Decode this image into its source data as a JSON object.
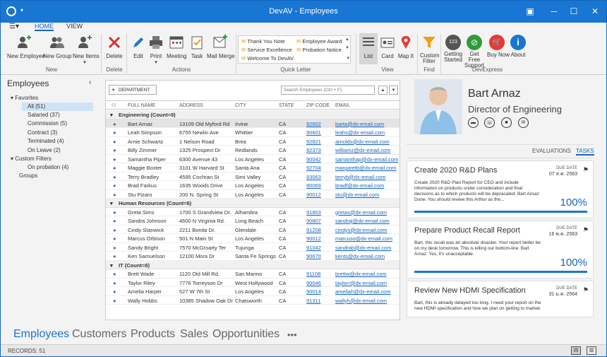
{
  "app": {
    "title": "DevAV - Employees"
  },
  "ribbon_tabs": [
    "HOME",
    "VIEW"
  ],
  "ribbon": {
    "buttons": [
      {
        "label": "New Employee",
        "icon": "add-person-icon",
        "group": "New"
      },
      {
        "label": "New Group",
        "icon": "add-group-icon",
        "group": "New"
      },
      {
        "label": "New Items",
        "icon": "add-items-icon",
        "group": "New"
      },
      {
        "label": "Delete",
        "icon": "delete-icon",
        "group": "Delete"
      },
      {
        "label": "Edit",
        "icon": "edit-icon",
        "group": "Actions"
      },
      {
        "label": "Print",
        "icon": "print-icon",
        "group": "Actions"
      },
      {
        "label": "Meeting",
        "icon": "meeting-icon",
        "group": "Actions"
      },
      {
        "label": "Task",
        "icon": "task-icon",
        "group": "Actions"
      },
      {
        "label": "Mail Merge",
        "icon": "mail-merge-icon",
        "group": "Actions"
      },
      {
        "label": "List",
        "icon": "list-icon",
        "group": "View"
      },
      {
        "label": "Card",
        "icon": "card-icon",
        "group": "View"
      },
      {
        "label": "Map It",
        "icon": "map-icon",
        "group": "View"
      },
      {
        "label": "Custom Filter",
        "icon": "filter-icon",
        "group": "Find"
      },
      {
        "label": "Getting Started",
        "icon": "getting-started-icon",
        "group": "DevExpress"
      },
      {
        "label": "Get Free Support",
        "icon": "support-icon",
        "group": "DevExpress"
      },
      {
        "label": "Buy Now",
        "icon": "buy-icon",
        "group": "DevExpress"
      },
      {
        "label": "About",
        "icon": "info-icon",
        "group": "DevExpress"
      }
    ],
    "groups": [
      "New",
      "Delete",
      "Actions",
      "Quick Letter",
      "View",
      "Find",
      "DevExpress"
    ],
    "quick_letter": [
      "Thank You Note",
      "Employee Award",
      "Service Excellence",
      "Probation Notice",
      "Welcome To DevAV"
    ],
    "getting_started_badge": "123"
  },
  "sidebar": {
    "title": "Employees",
    "favorites_label": "Favorites",
    "items": [
      "All (51)",
      "Salaried (37)",
      "Commission (5)",
      "Contract (3)",
      "Terminated (4)",
      "On Leave (2)"
    ],
    "custom_filters_label": "Custom Filters",
    "custom_items": [
      "On probation  (4)"
    ],
    "groups_label": "Groups"
  },
  "grid": {
    "department_label": "DEPARTMENT",
    "search_placeholder": "Search Employees (Ctrl + F)",
    "columns": [
      "FULL NAME",
      "ADDRESS",
      "CITY",
      "STATE",
      "ZIP CODE",
      "EMAIL"
    ],
    "groups": [
      {
        "title": "Engineering (Count=9)",
        "rows": [
          [
            "Bart Arnaz",
            "13109 Old Myford Rd",
            "Irvine",
            "CA",
            "92602",
            "barta@dx-email.com"
          ],
          [
            "Leah Simpson",
            "6755 Newlin Ave",
            "Whittier",
            "CA",
            "90601",
            "leahs@dx-email.com"
          ],
          [
            "Arnie Schwartz",
            "1 Nelson Road",
            "Brea",
            "CA",
            "92821",
            "arnolds@dx-email.com"
          ],
          [
            "Billy Zimmer",
            "1325 Prospect Dr",
            "Redlands",
            "CA",
            "92373",
            "williamz@dx-email.com"
          ],
          [
            "Samantha Piper",
            "6300 Avenue 43",
            "Los Angeles",
            "CA",
            "90042",
            "samanthap@dx-email.com"
          ],
          [
            "Maggie Boxter",
            "3101 W Harvard St",
            "Santa Ana",
            "CA",
            "92704",
            "margaretb@dx-email.com"
          ],
          [
            "Terry Bradley",
            "4595 Cochran St",
            "Simi Valley",
            "CA",
            "93063",
            "terryb@dx-email.com"
          ],
          [
            "Brad Farkus",
            "1635 Woods Drive",
            "Los Angeles",
            "CA",
            "90069",
            "bradf@dx-email.com"
          ],
          [
            "Stu Pizaro",
            "200 N. Spring St",
            "Los Angeles",
            "CA",
            "90012",
            "stu@dx-email.com"
          ]
        ]
      },
      {
        "title": "Human Resources (Count=6)",
        "rows": [
          [
            "Greta Sims",
            "1700 S Grandview Dr.",
            "Alhambra",
            "CA",
            "91803",
            "gretas@dx-email.com"
          ],
          [
            "Sandra Johnson",
            "4600 N Virginia Rd.",
            "Long Beach",
            "CA",
            "90807",
            "sandraj@dx-email.com"
          ],
          [
            "Cindy Stanwick",
            "2211 Bonita Dr.",
            "Glendale",
            "CA",
            "91208",
            "cindys@dx-email.com"
          ],
          [
            "Marcus Orbison",
            "501 N Main St",
            "Los Angeles",
            "CA",
            "90012",
            "marcuso@dx-email.com"
          ],
          [
            "Sandy Bright",
            "7570 McGroarty Ter",
            "Tujunga",
            "CA",
            "91042",
            "sandrab@dx-email.com"
          ],
          [
            "Ken Samuelson",
            "12100 Mora Dr",
            "Santa Fe Springs",
            "CA",
            "90670",
            "kents@dx-email.com"
          ]
        ]
      },
      {
        "title": "IT (Count=8)",
        "rows": [
          [
            "Brett Wade",
            "1120 Old Mill Rd.",
            "San Marino",
            "CA",
            "91108",
            "brettw@dx-email.com"
          ],
          [
            "Taylor Riley",
            "7776 Torreyson Dr",
            "West Hollywood",
            "CA",
            "90046",
            "taylorr@dx-email.com"
          ],
          [
            "Amelia Harper",
            "527 W 7th St",
            "Los Angeles",
            "CA",
            "90014",
            "ameliah@dx-email.com"
          ],
          [
            "Wally Hobbs",
            "10385 Shadow Oak Dr",
            "Chatsworth",
            "CA",
            "91311",
            "wallyh@dx-email.com"
          ]
        ]
      }
    ]
  },
  "detail": {
    "name": "Bart Arnaz",
    "title": "Director of Engineering",
    "tabs": [
      "EVALUATIONS",
      "TASKS"
    ],
    "tasks": [
      {
        "title": "Create 2020 R&D Plans",
        "due_label": "DUE DATE",
        "due": "07 ส.ค. 2563",
        "desc": "Create 2020 R&D Plan Report for CEO and include information on products under consideration and final decisions as to which products will be depracated. Bart Arnaz: Done. You should review this Arthur as the...",
        "pct": "100%"
      },
      {
        "title": "Prepare Product Recall Report",
        "due_label": "DUE DATE",
        "due": "16 พ.ค. 2563",
        "desc": "Bart, this recall was an absolute disaster. Your report better be on my desk tomorrow. This is killing our bottom-line. Bart Arnaz: Yes, it's unacceptable.",
        "pct": "100%"
      },
      {
        "title": "Review New HDMI Specification",
        "due_label": "DUE DATE",
        "due": "31 ม.ค. 2564",
        "desc": "Bart, this is already delayed too long. I need your report on the new HDMI specification and how we plan on getting to market.",
        "pct": ""
      }
    ]
  },
  "bottom_nav": [
    "Employees",
    "Customers",
    "Products",
    "Sales",
    "Opportunities",
    "•••"
  ],
  "status": {
    "records": "RECORDS: 51"
  }
}
